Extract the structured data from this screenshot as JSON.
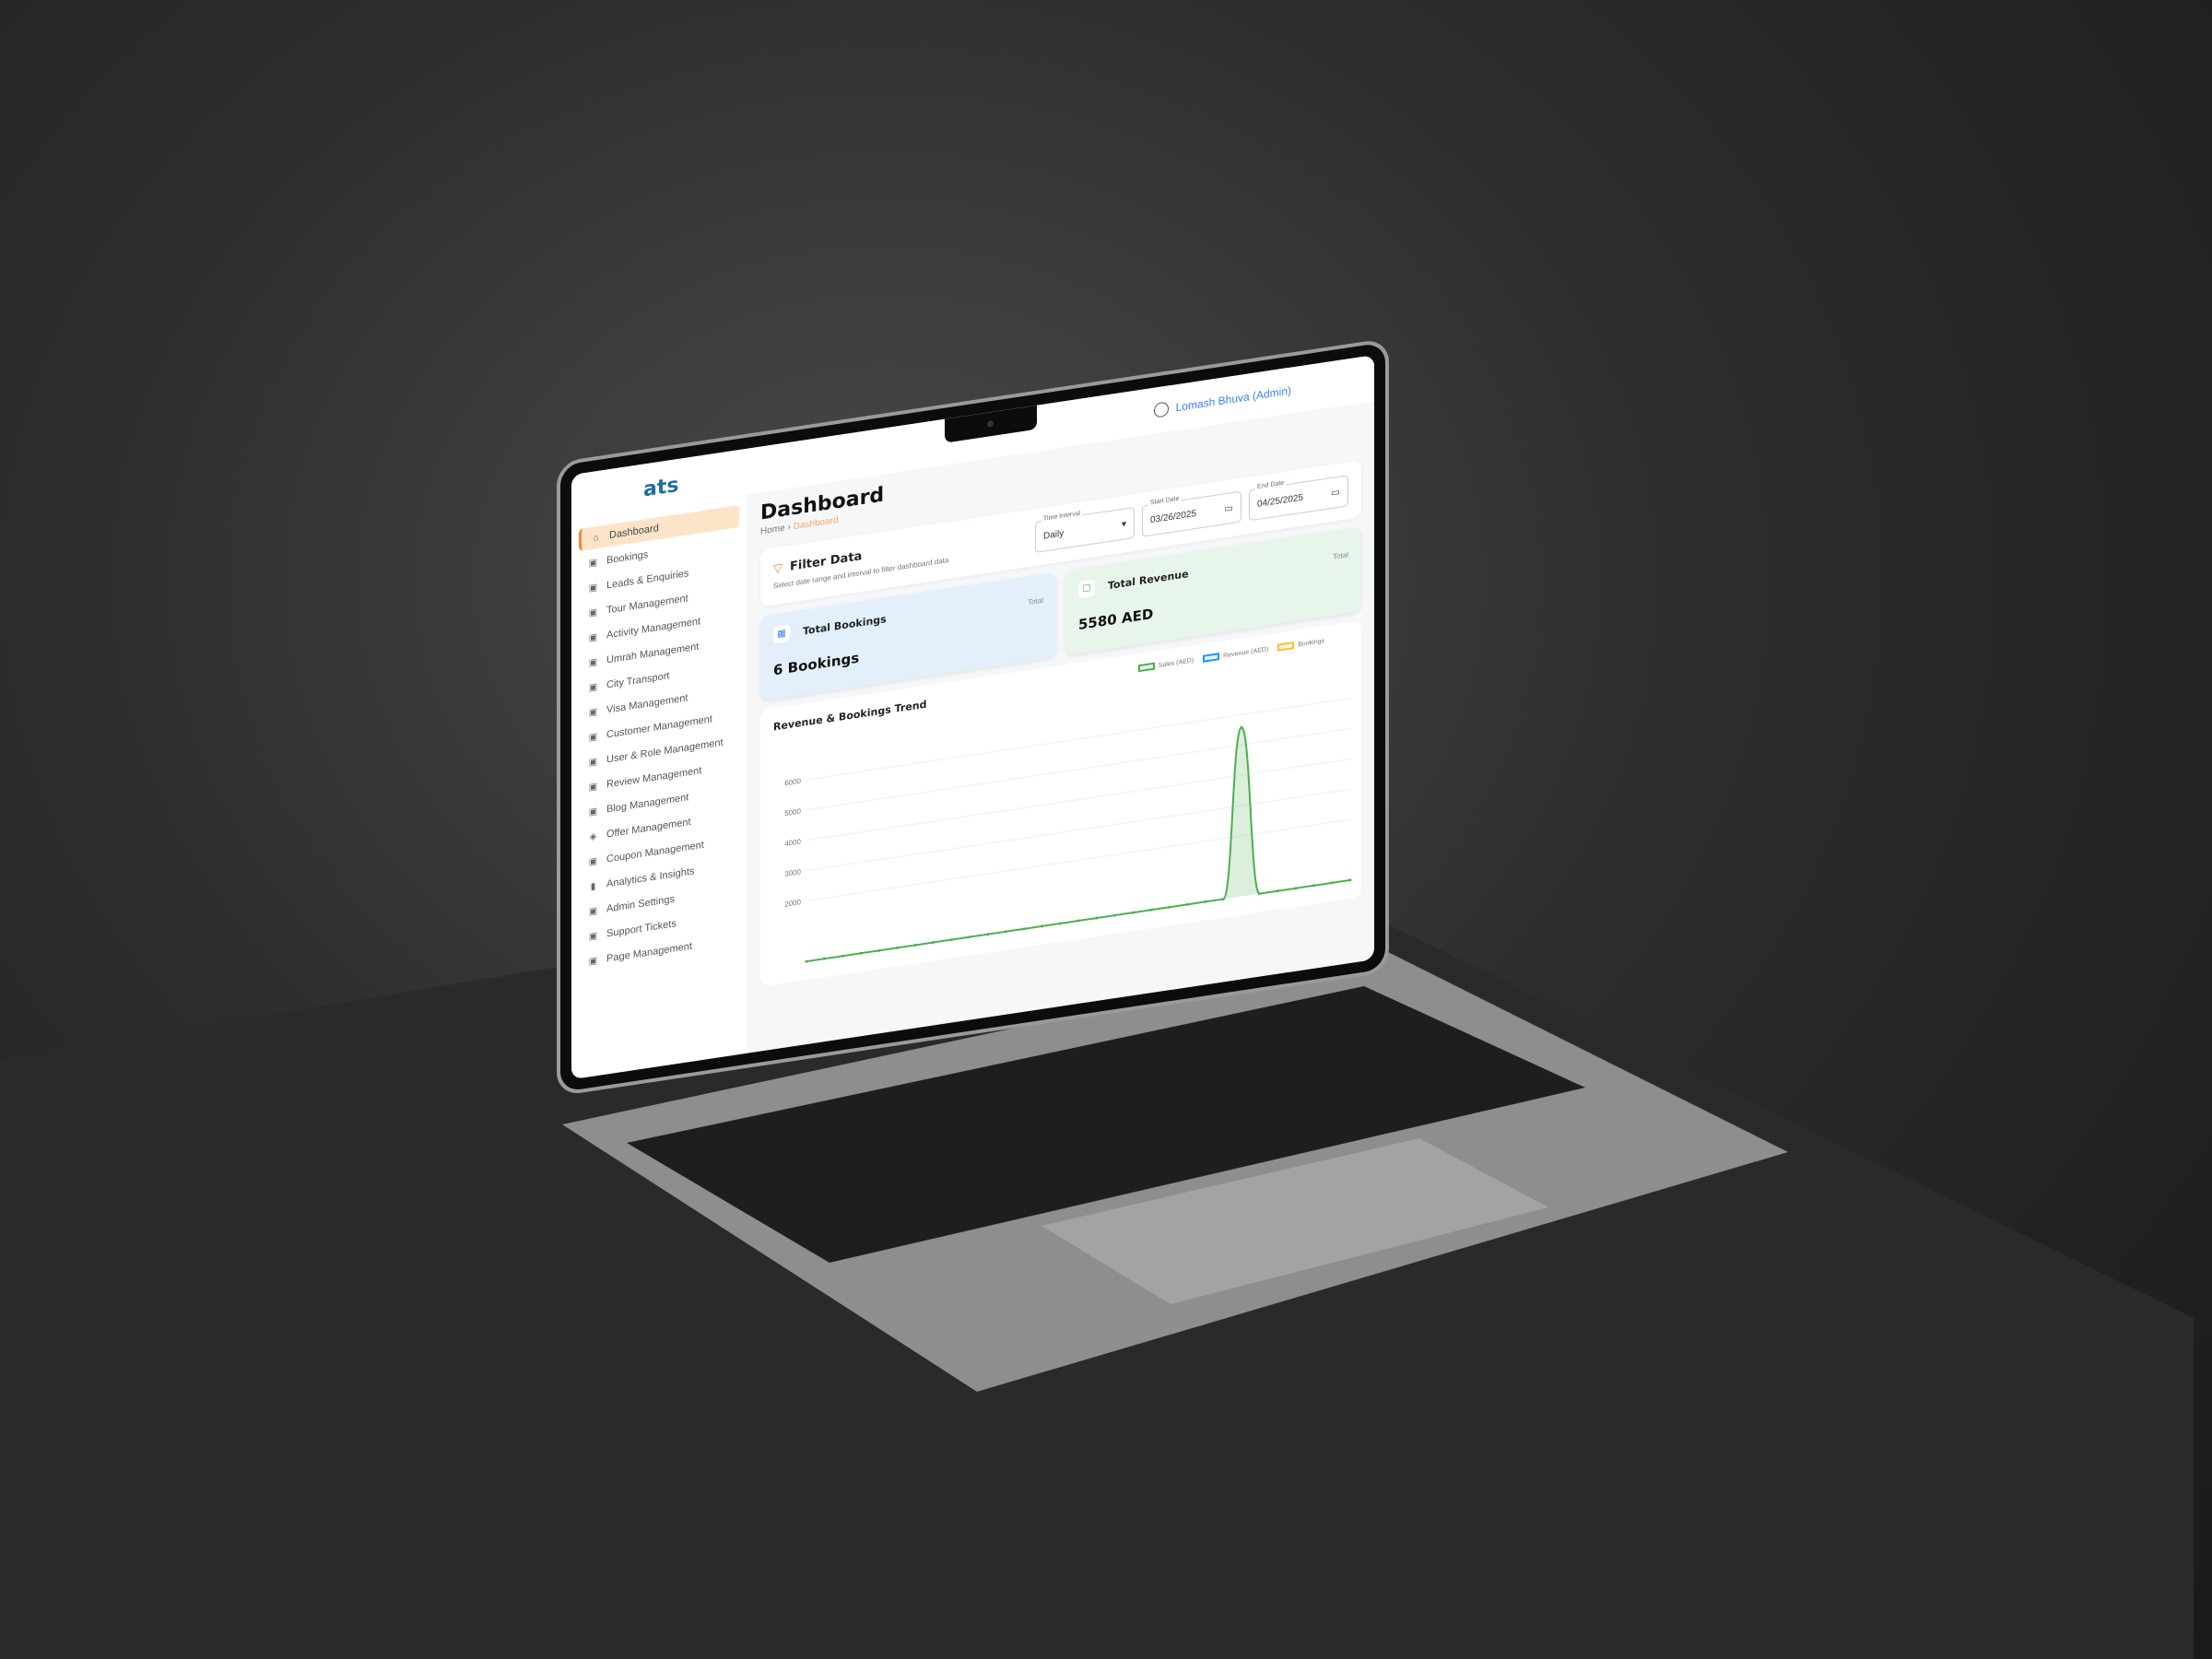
{
  "header": {
    "user_name": "Lomash Bhuva (Admin)",
    "icon": "user-circle-icon"
  },
  "logo": {
    "text": "ats"
  },
  "sidebar": {
    "items": [
      {
        "label": "Dashboard",
        "icon": "home-icon",
        "active": true
      },
      {
        "label": "Bookings",
        "icon": "calendar-icon"
      },
      {
        "label": "Leads & Enquiries",
        "icon": "leads-icon"
      },
      {
        "label": "Tour Management",
        "icon": "tour-icon"
      },
      {
        "label": "Activity Management",
        "icon": "activity-icon"
      },
      {
        "label": "Umrah Management",
        "icon": "mosque-icon"
      },
      {
        "label": "City Transport",
        "icon": "bus-icon"
      },
      {
        "label": "Visa Management",
        "icon": "passport-icon"
      },
      {
        "label": "Customer Management",
        "icon": "customer-icon"
      },
      {
        "label": "User & Role Management",
        "icon": "users-icon"
      },
      {
        "label": "Review Management",
        "icon": "review-icon"
      },
      {
        "label": "Blog Management",
        "icon": "blog-icon"
      },
      {
        "label": "Offer Management",
        "icon": "tag-icon"
      },
      {
        "label": "Coupon Management",
        "icon": "coupon-icon"
      },
      {
        "label": "Analytics & Insights",
        "icon": "bar-chart-icon"
      },
      {
        "label": "Admin Settings",
        "icon": "admin-icon"
      },
      {
        "label": "Support Tickets",
        "icon": "ticket-icon"
      },
      {
        "label": "Page Management",
        "icon": "page-icon"
      }
    ]
  },
  "page": {
    "title": "Dashboard",
    "breadcrumb": {
      "home": "Home",
      "sep": "›",
      "current": "Dashboard"
    }
  },
  "filter": {
    "title": "Filter Data",
    "subtitle": "Select date range and interval to filter dashboard data",
    "time_interval": {
      "label": "Time Interval",
      "value": "Daily"
    },
    "start_date": {
      "label": "Start Date",
      "value": "03/26/2025"
    },
    "end_date": {
      "label": "End Date",
      "value": "04/25/2025"
    }
  },
  "cards": {
    "bookings": {
      "title": "Total Bookings",
      "tag": "Total",
      "value": "6 Bookings"
    },
    "revenue": {
      "title": "Total Revenue",
      "tag": "Total",
      "value": "5580 AED"
    }
  },
  "colors": {
    "accent": "#f08a3c",
    "sales": "#4caf50",
    "revenue": "#2196f3",
    "bookings": "#fbc02d",
    "link": "#3b82f6"
  },
  "chart_data": {
    "type": "line",
    "title": "Revenue & Bookings Trend",
    "y_ticks": [
      "6000",
      "5000",
      "4000",
      "3000",
      "2000"
    ],
    "ylim": [
      0,
      7000
    ],
    "grid": true,
    "legend_position": "top-right",
    "series": [
      {
        "name": "Sales (AED)",
        "color": "#4caf50",
        "values": [
          0,
          0,
          0,
          0,
          0,
          0,
          0,
          0,
          0,
          0,
          0,
          0,
          0,
          0,
          0,
          0,
          0,
          0,
          0,
          0,
          0,
          0,
          0,
          0,
          5580,
          0,
          0,
          0,
          0,
          0,
          0
        ]
      },
      {
        "name": "Revenue (AED)",
        "color": "#2196f3"
      },
      {
        "name": "Bookings",
        "color": "#fbc02d"
      }
    ]
  }
}
